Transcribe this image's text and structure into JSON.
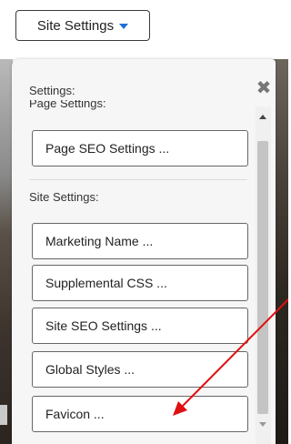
{
  "trigger": {
    "label": "Site Settings",
    "icon": "caret-down-icon",
    "accent": "#1f6fd6"
  },
  "panel": {
    "settings_label": "Settings:",
    "page_settings_label": "Page Settings:",
    "page_buttons": [
      "Page SEO Settings ..."
    ],
    "site_settings_label": "Site Settings:",
    "site_buttons": [
      "Marketing Name ...",
      "Supplemental CSS ...",
      "Site SEO Settings ...",
      "Global Styles ...",
      "Favicon ..."
    ],
    "close_icon": "close-icon"
  },
  "annotation": {
    "color": "#e01010",
    "icon": "red-arrow-icon"
  }
}
